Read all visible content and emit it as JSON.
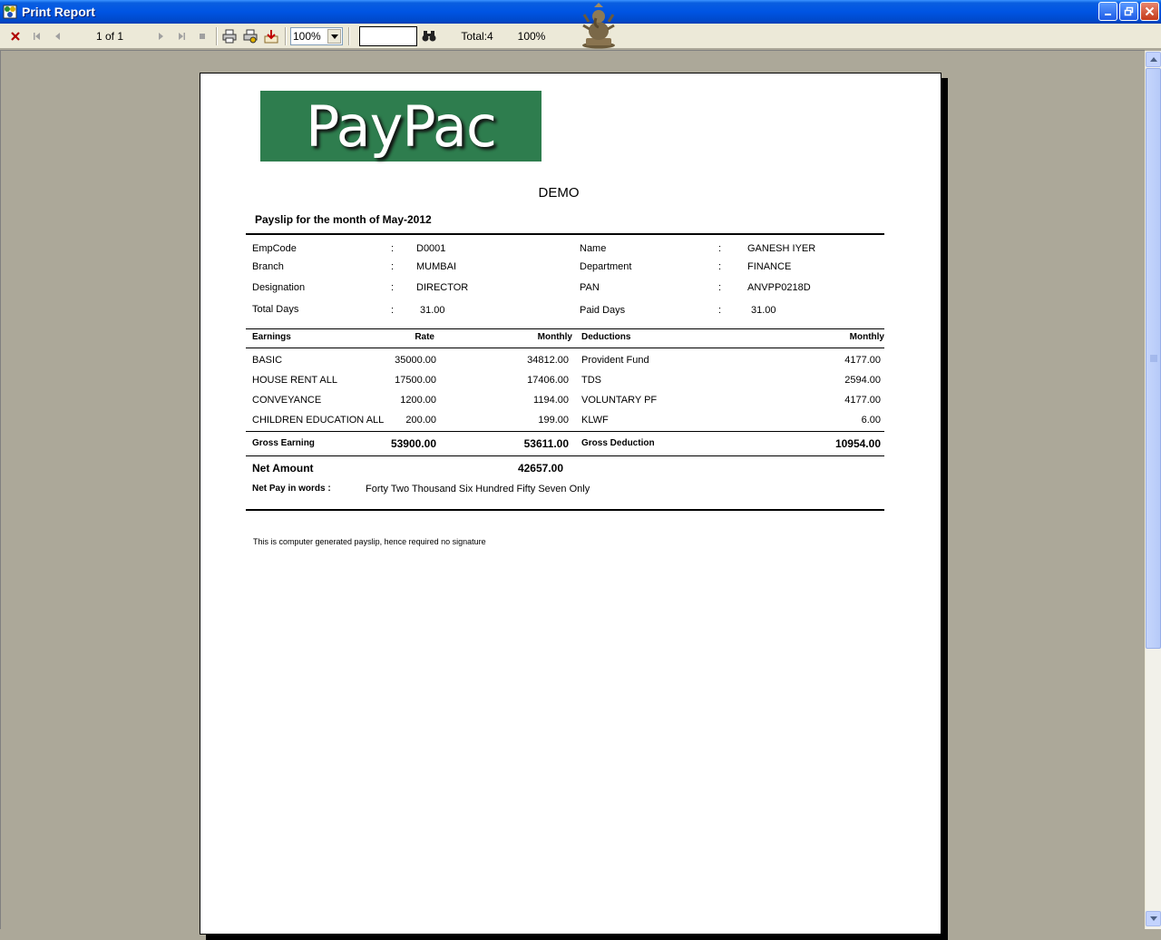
{
  "window": {
    "title": "Print Report"
  },
  "toolbar": {
    "page_indicator": "1 of 1",
    "zoom_value": "100%",
    "search_value": "",
    "total": "Total:4",
    "percent": "100%"
  },
  "report": {
    "logo_text": "PayPac",
    "company": "DEMO",
    "title": "Payslip for the month of May-2012",
    "details": {
      "empcode_label": "EmpCode",
      "empcode": "D0001",
      "name_label": "Name",
      "name": "GANESH IYER",
      "branch_label": "Branch",
      "branch": "MUMBAI",
      "department_label": "Department",
      "department": "FINANCE",
      "designation_label": "Designation",
      "designation": "DIRECTOR",
      "pan_label": "PAN",
      "pan": "ANVPP0218D",
      "total_days_label": "Total Days",
      "total_days": "31.00",
      "paid_days_label": "Paid Days",
      "paid_days": "31.00",
      "colon": ":"
    },
    "table_headers": {
      "earnings": "Earnings",
      "rate": "Rate",
      "monthly": "Monthly",
      "deductions": "Deductions",
      "deductions_monthly": "Monthly"
    },
    "earnings": [
      {
        "name": "BASIC",
        "rate": "35000.00",
        "monthly": "34812.00"
      },
      {
        "name": "HOUSE RENT ALL",
        "rate": "17500.00",
        "monthly": "17406.00"
      },
      {
        "name": "CONVEYANCE",
        "rate": "1200.00",
        "monthly": "1194.00"
      },
      {
        "name": "CHILDREN EDUCATION ALL",
        "rate": "200.00",
        "monthly": "199.00"
      }
    ],
    "deductions": [
      {
        "name": "Provident Fund",
        "monthly": "4177.00"
      },
      {
        "name": "TDS",
        "monthly": "2594.00"
      },
      {
        "name": "VOLUNTARY PF",
        "monthly": "4177.00"
      },
      {
        "name": "KLWF",
        "monthly": "6.00"
      }
    ],
    "totals": {
      "gross_earning_label": "Gross Earning",
      "gross_earning_rate": "53900.00",
      "gross_earning_monthly": "53611.00",
      "gross_deduction_label": "Gross Deduction",
      "gross_deduction": "10954.00"
    },
    "net": {
      "label": "Net Amount",
      "amount": "42657.00",
      "words_label": "Net Pay in words :",
      "words": "Forty Two Thousand Six Hundred Fifty Seven Only"
    },
    "footer_note": "This is computer generated payslip, hence required no signature"
  }
}
